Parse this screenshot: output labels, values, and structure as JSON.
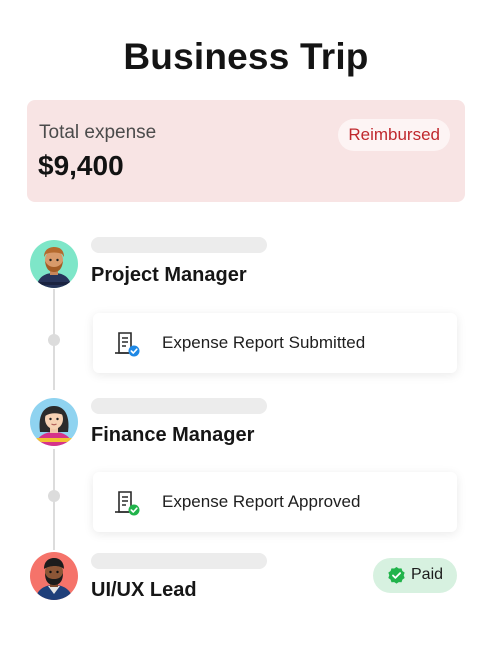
{
  "page": {
    "title": "Business Trip"
  },
  "summary": {
    "label": "Total expense",
    "amount": "$9,400",
    "status": "Reimbursed"
  },
  "timeline": {
    "steps": [
      {
        "role": "Project Manager",
        "avatar": "avatar-project-manager"
      },
      {
        "role": "Finance Manager",
        "avatar": "avatar-finance-manager"
      },
      {
        "role": "UI/UX Lead",
        "avatar": "avatar-uiux-lead"
      }
    ],
    "events": [
      {
        "text": "Expense Report Submitted",
        "icon": "report-submitted-icon"
      },
      {
        "text": "Expense Report Approved",
        "icon": "report-approved-icon"
      }
    ],
    "payment_status": "Paid"
  },
  "colors": {
    "summary_bg": "#f8e4e4",
    "reimbursed": "#c0282d",
    "paid_bg": "#d7f1e0",
    "success": "#21b34b",
    "info": "#1e88e5"
  }
}
